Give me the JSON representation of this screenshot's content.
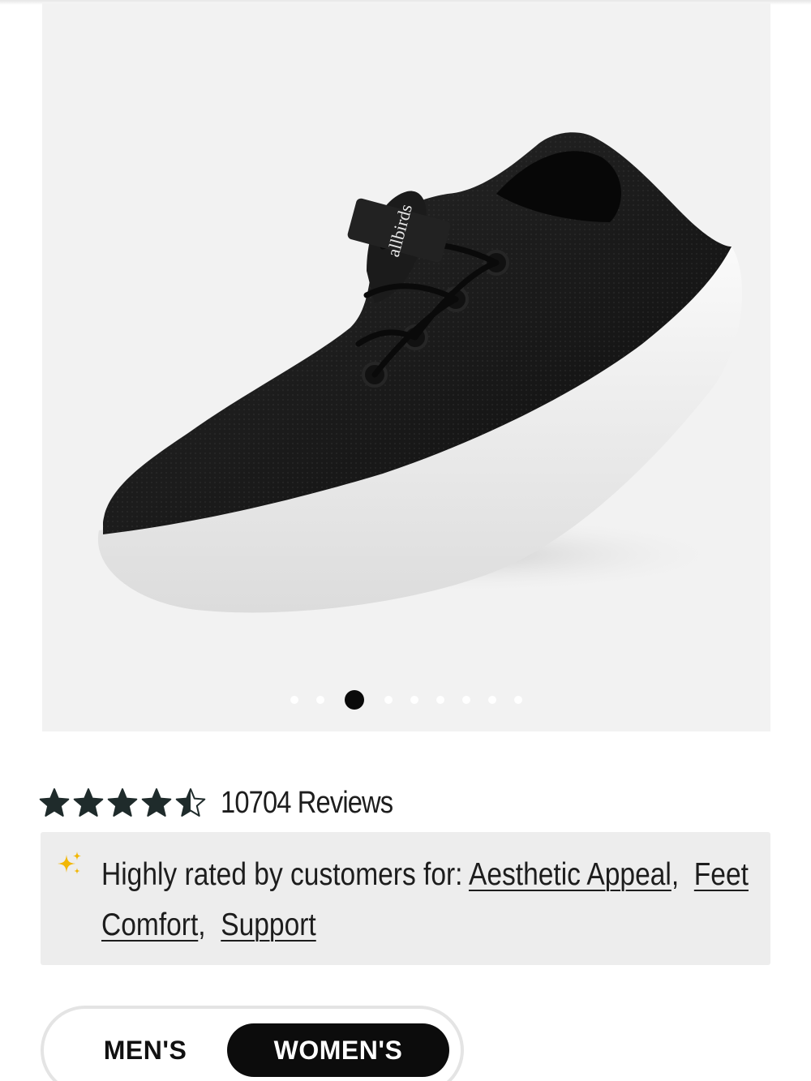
{
  "gallery": {
    "image_alt": "Black knit sneaker with white sole",
    "brand_mark": "allbirds",
    "slide_count": 9,
    "active_slide": 3
  },
  "rating": {
    "stars": 4.5,
    "max_stars": 5,
    "review_count_label": "10704 Reviews"
  },
  "highlights": {
    "intro": "Highly rated by customers for:",
    "tags": [
      "Aesthetic Appeal",
      "Feet Comfort",
      "Support"
    ],
    "icon": "sparkle-icon",
    "accent_color": "#f2b705"
  },
  "gender": {
    "options": [
      "MEN'S",
      "WOMEN'S"
    ],
    "selected": "WOMEN'S"
  }
}
